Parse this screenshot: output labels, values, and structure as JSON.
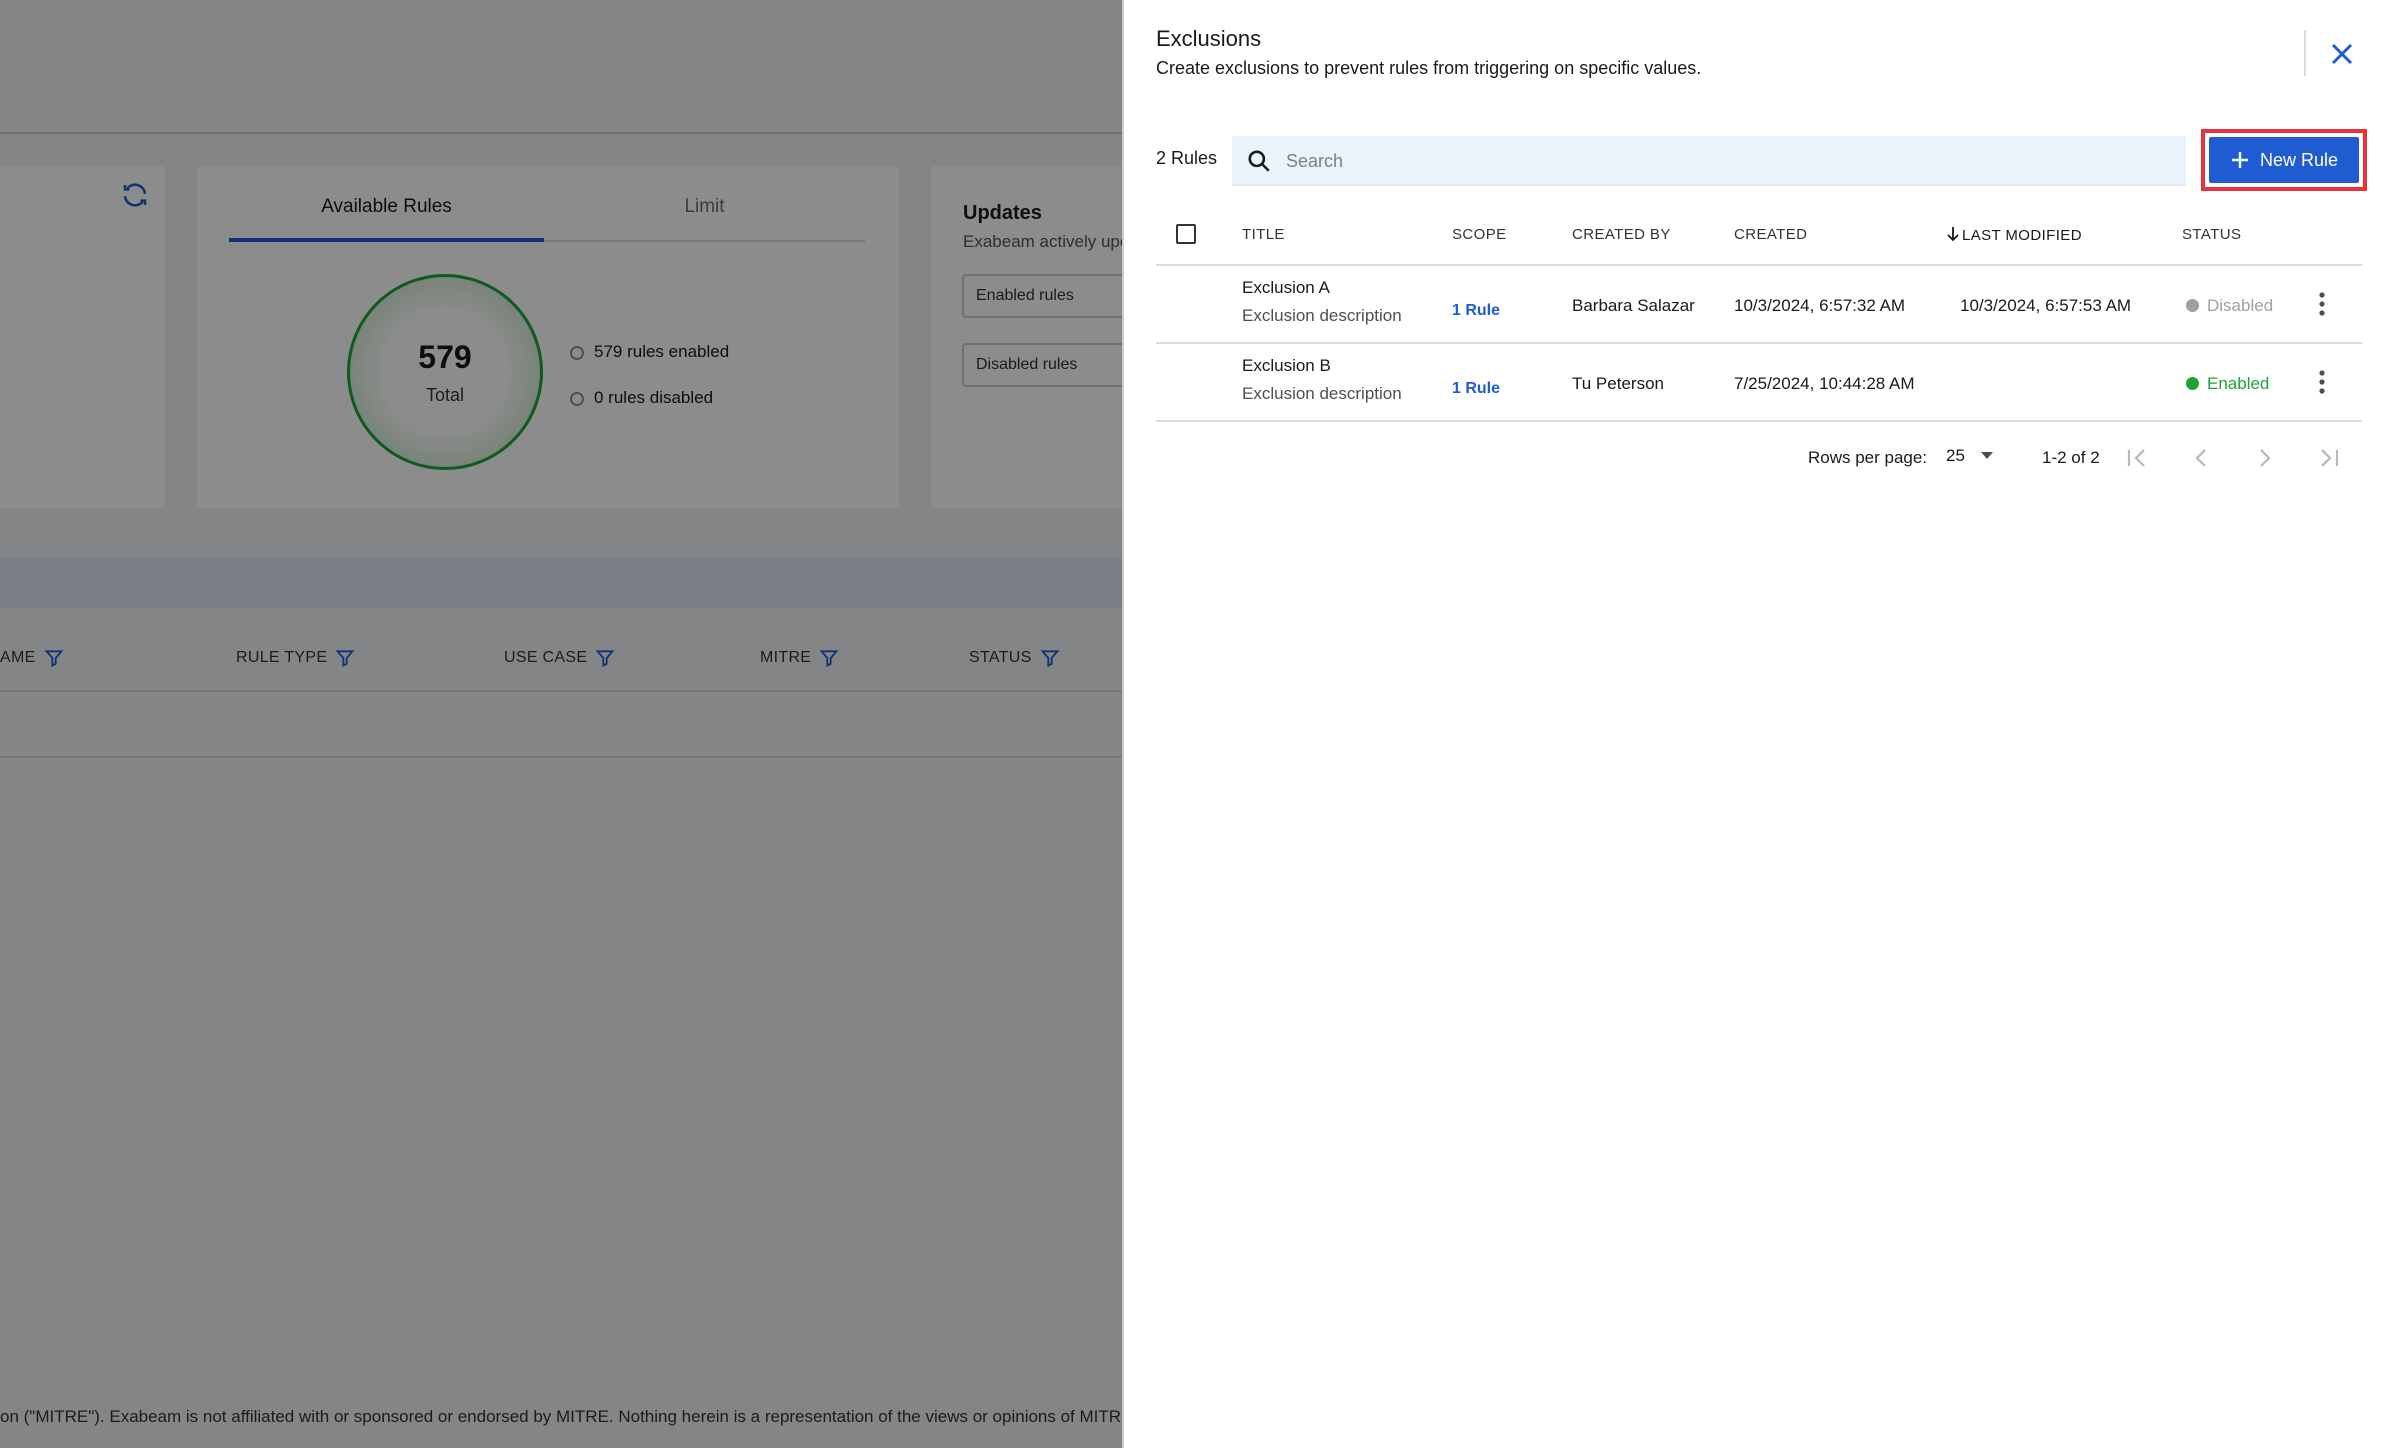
{
  "background": {
    "tabs": [
      "Available Rules",
      "Limit"
    ],
    "donut": {
      "value": "579",
      "label": "Total"
    },
    "legend": [
      "579 rules enabled",
      "0 rules disabled"
    ],
    "updates": {
      "title": "Updates",
      "desc": "Exabeam actively upd",
      "enabled_btn": "Enabled rules",
      "disabled_btn": "Disabled rules"
    },
    "columns": [
      "AME",
      "RULE TYPE",
      "USE CASE",
      "MITRE",
      "STATUS"
    ],
    "footer": "on (\"MITRE\"). Exabeam is not affiliated with or sponsored or endorsed by MITRE. Nothing herein is a representation of the views or opinions of MITRE"
  },
  "drawer": {
    "title": "Exclusions",
    "subtitle": "Create exclusions to prevent rules from triggering on specific values.",
    "rules_count": "2 Rules",
    "search_placeholder": "Search",
    "new_rule_label": "New Rule",
    "columns": {
      "title": "TITLE",
      "scope": "SCOPE",
      "created_by": "CREATED BY",
      "created": "CREATED",
      "last_modified": "LAST MODIFIED",
      "status": "STATUS"
    },
    "rows": [
      {
        "title": "Exclusion A",
        "desc": "Exclusion description",
        "scope": "1 Rule",
        "created_by": "Barbara Salazar",
        "created": "10/3/2024, 6:57:32 AM",
        "last_modified": "10/3/2024, 6:57:53 AM",
        "status": "Disabled"
      },
      {
        "title": "Exclusion B",
        "desc": "Exclusion description",
        "scope": "1 Rule",
        "created_by": "Tu Peterson",
        "created": "7/25/2024, 10:44:28 AM",
        "last_modified": "",
        "status": "Enabled"
      }
    ],
    "pagination": {
      "rows_per_page_label": "Rows per page:",
      "rows_per_page": "25",
      "range": "1-2 of 2"
    },
    "colors": {
      "accent": "#1f5bd1",
      "enabled": "#1ea33a",
      "disabled": "#9aa1a9",
      "highlight": "#e8333f"
    }
  }
}
